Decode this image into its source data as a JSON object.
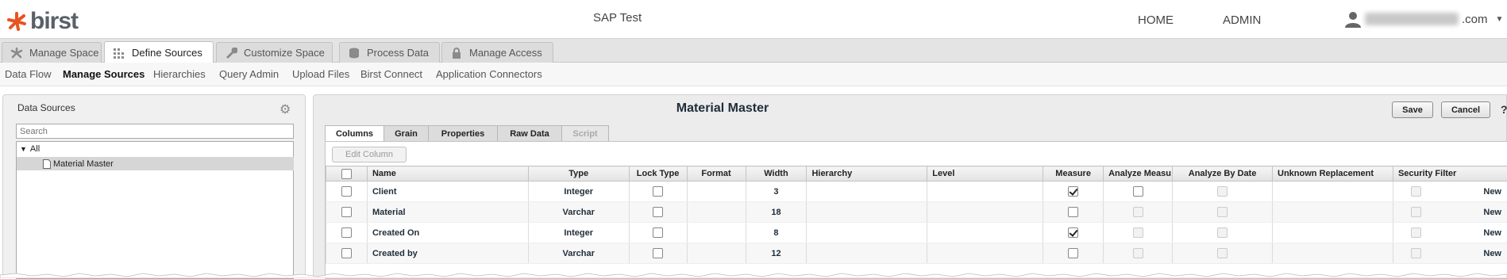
{
  "app": {
    "logo_text": "birst",
    "space_title": "SAP Test"
  },
  "top_nav": {
    "home": "HOME",
    "admin": "ADMIN",
    "user_suffix": ".com"
  },
  "main_tabs": [
    {
      "label": "Manage Space",
      "icon": "manage-space-icon"
    },
    {
      "label": "Define Sources",
      "icon": "define-sources-icon"
    },
    {
      "label": "Customize Space",
      "icon": "wrench-icon"
    },
    {
      "label": "Process Data",
      "icon": "database-icon"
    },
    {
      "label": "Manage Access",
      "icon": "lock-icon"
    }
  ],
  "sub_nav": [
    "Data Flow",
    "Manage Sources",
    "Hierarchies",
    "Query Admin",
    "Upload Files",
    "Birst Connect",
    "Application Connectors"
  ],
  "left_panel": {
    "title": "Data Sources",
    "search_placeholder": "Search",
    "tree_root": "All",
    "tree_item": "Material Master"
  },
  "main_panel": {
    "title": "Material Master",
    "save": "Save",
    "cancel": "Cancel",
    "help": "?",
    "tabs": [
      "Columns",
      "Grain",
      "Properties",
      "Raw Data",
      "Script"
    ],
    "edit_column": "Edit Column"
  },
  "grid": {
    "headers": [
      "Name",
      "Type",
      "Lock Type",
      "Format",
      "Width",
      "Hierarchy",
      "Level",
      "Measure",
      "Analyze Measu",
      "Analyze By Date",
      "Unknown Replacement",
      "Security Filter"
    ],
    "rows": [
      {
        "name": "Client",
        "type": "Integer",
        "width": "3",
        "measure": true,
        "analyze_measure_enabled": true,
        "security_filter": "New"
      },
      {
        "name": "Material",
        "type": "Varchar",
        "width": "18",
        "measure": false,
        "analyze_measure_enabled": false,
        "security_filter": "New"
      },
      {
        "name": "Created On",
        "type": "Integer",
        "width": "8",
        "measure": true,
        "analyze_measure_enabled": false,
        "security_filter": "New"
      },
      {
        "name": "Created by",
        "type": "Varchar",
        "width": "12",
        "measure": false,
        "analyze_measure_enabled": false,
        "security_filter": "New"
      }
    ]
  },
  "colors": {
    "logo_accent": "#e8531f",
    "title_text": "#1f2d3a"
  }
}
